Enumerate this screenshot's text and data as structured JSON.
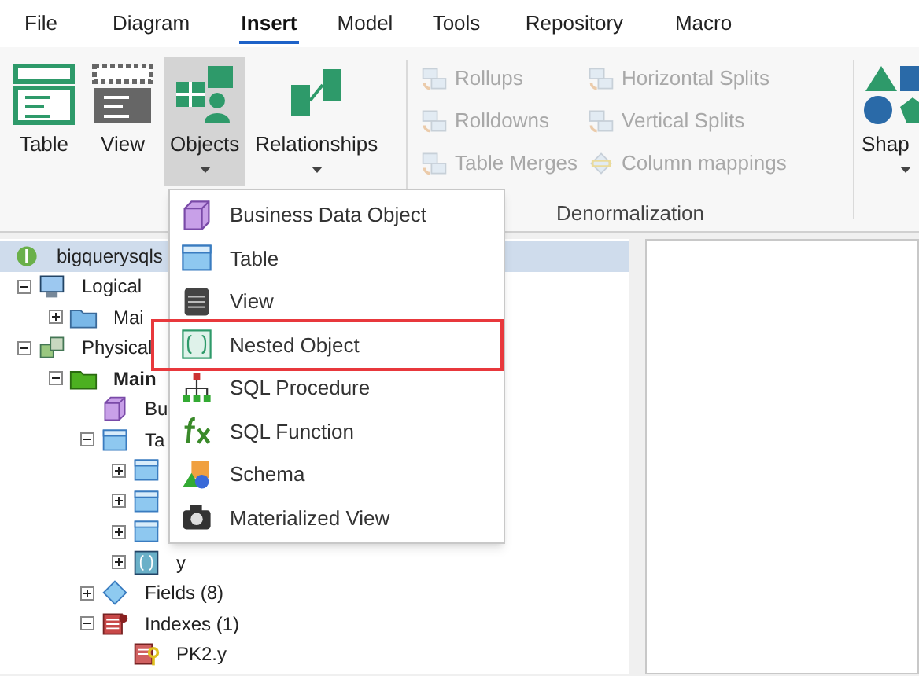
{
  "menu_tabs": [
    {
      "label": "File",
      "selected": false
    },
    {
      "label": "Diagram",
      "selected": false
    },
    {
      "label": "Insert",
      "selected": true
    },
    {
      "label": "Model",
      "selected": false
    },
    {
      "label": "Tools",
      "selected": false
    },
    {
      "label": "Repository",
      "selected": false
    },
    {
      "label": "Macro",
      "selected": false
    }
  ],
  "ribbon": {
    "large_buttons": [
      {
        "kind": "table",
        "label": "Table",
        "pressed": false,
        "dropdown": false
      },
      {
        "kind": "view",
        "label": "View",
        "pressed": false,
        "dropdown": false
      },
      {
        "kind": "objects",
        "label": "Objects",
        "pressed": true,
        "dropdown": true
      },
      {
        "kind": "relationships",
        "label": "Relationships",
        "pressed": false,
        "dropdown": true
      }
    ],
    "denormalization": {
      "label": "Denormalization",
      "columns": [
        [
          {
            "kind": "rollups",
            "label": "Rollups",
            "disabled": true
          },
          {
            "kind": "rolldowns",
            "label": "Rolldowns",
            "disabled": true
          },
          {
            "kind": "merges",
            "label": "Table Merges",
            "disabled": true
          }
        ],
        [
          {
            "kind": "hsplit",
            "label": "Horizontal Splits",
            "disabled": true
          },
          {
            "kind": "vsplit",
            "label": "Vertical Splits",
            "disabled": true
          },
          {
            "kind": "mapping",
            "label": "Column mappings",
            "disabled": true
          }
        ]
      ]
    },
    "shapes_button": {
      "label": "Shap"
    }
  },
  "tree": [
    {
      "kind": "root",
      "label": "bigquerysqls",
      "selected": true,
      "children": [
        {
          "kind": "logical",
          "label": "Logical",
          "expanded": true,
          "selected": false,
          "children": [
            {
              "kind": "folder",
              "label": "Mai",
              "expanded": false,
              "selected": false
            }
          ]
        },
        {
          "kind": "physical",
          "label": "Physical",
          "expanded": true,
          "selected": false,
          "children": [
            {
              "kind": "greenfolder",
              "label": "Main",
              "expanded": true,
              "selected": false,
              "children": [
                {
                  "kind": "cube",
                  "label": "Bu",
                  "selected": false
                },
                {
                  "kind": "table",
                  "label": "Ta",
                  "expanded": true,
                  "selected": false,
                  "children": [
                    {
                      "kind": "table",
                      "expanded": false,
                      "selected": false
                    },
                    {
                      "kind": "table",
                      "expanded": false,
                      "selected": false
                    },
                    {
                      "kind": "table",
                      "expanded": false,
                      "selected": false
                    },
                    {
                      "kind": "nested",
                      "label": "y",
                      "expanded": false,
                      "selected": false
                    }
                  ]
                },
                {
                  "kind": "diamond",
                  "label": "Fields (8)",
                  "expanded": false,
                  "selected": false
                },
                {
                  "kind": "index",
                  "label": "Indexes (1)",
                  "expanded": true,
                  "selected": false,
                  "children": [
                    {
                      "kind": "key",
                      "label": "PK2.y",
                      "selected": false
                    }
                  ]
                }
              ]
            }
          ]
        }
      ]
    }
  ],
  "dropdown_menu": [
    {
      "kind": "cube",
      "label": "Business Data Object",
      "annotated": false
    },
    {
      "kind": "table",
      "label": "Table",
      "annotated": false
    },
    {
      "kind": "view",
      "label": "View",
      "annotated": false
    },
    {
      "kind": "nested",
      "label": "Nested Object",
      "annotated": true
    },
    {
      "kind": "procedure",
      "label": "SQL Procedure",
      "annotated": false
    },
    {
      "kind": "function",
      "label": "SQL Function",
      "annotated": false
    },
    {
      "kind": "schema",
      "label": "Schema",
      "annotated": false
    },
    {
      "kind": "matview",
      "label": "Materialized View",
      "annotated": false
    }
  ]
}
